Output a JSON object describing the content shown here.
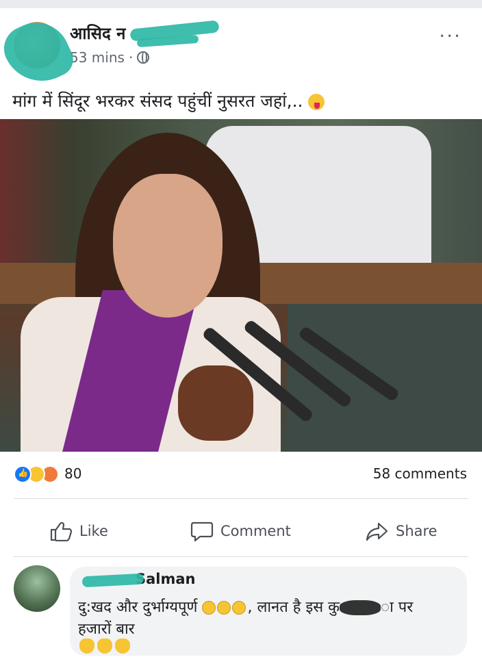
{
  "post": {
    "author": "आसिद न",
    "time": "53 mins",
    "separator": "·",
    "more_label": "···",
    "caption": "मांग में सिंदूर भरकर संसद पहुंचीं नुसरत जहां,.."
  },
  "stats": {
    "reaction_count": "80",
    "comments": "58 comments"
  },
  "actions": {
    "like": "Like",
    "comment": "Comment",
    "share": "Share"
  },
  "comment": {
    "author": "Salman",
    "text_part1": "दु:खद और दुर्भाग्यपूर्ण",
    "text_part2": ", लानत है इस कु",
    "text_part3": "ा पर",
    "text_line2": "हजारों बार"
  },
  "colors": {
    "like_blue": "#1877f2",
    "text": "#1c1e21",
    "secondary_text": "#606770",
    "bubble": "#f2f3f5",
    "redaction": "#2fb7a6"
  },
  "icons": {
    "more": "ellipsis-icon",
    "privacy": "globe-icon",
    "like": "thumbs-up-icon",
    "comment": "speech-bubble-icon",
    "share": "share-arrow-icon"
  }
}
